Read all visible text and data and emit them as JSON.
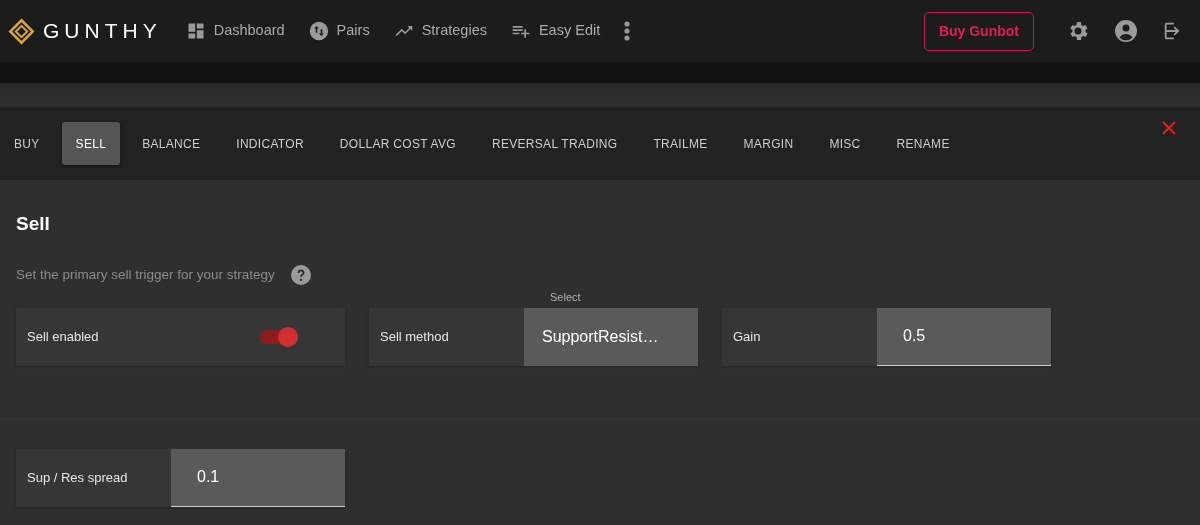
{
  "brand": "GUNTHY",
  "nav": [
    {
      "label": "Dashboard"
    },
    {
      "label": "Pairs"
    },
    {
      "label": "Strategies"
    },
    {
      "label": "Easy Edit"
    }
  ],
  "buy_button": "Buy Gunbot",
  "tabs": [
    {
      "label": "BUY",
      "selected": false
    },
    {
      "label": "SELL",
      "selected": true
    },
    {
      "label": "BALANCE",
      "selected": false
    },
    {
      "label": "INDICATOR",
      "selected": false
    },
    {
      "label": "DOLLAR COST AVG",
      "selected": false
    },
    {
      "label": "REVERSAL TRADING",
      "selected": false
    },
    {
      "label": "TRAILME",
      "selected": false
    },
    {
      "label": "MARGIN",
      "selected": false
    },
    {
      "label": "MISC",
      "selected": false
    },
    {
      "label": "RENAME",
      "selected": false
    }
  ],
  "section": {
    "title": "Sell",
    "description": "Set the primary sell trigger for your strategy",
    "settings": [
      {
        "kind": "toggle",
        "label": "Sell enabled",
        "on": true
      },
      {
        "kind": "select",
        "label": "Sell method",
        "floating_label": "Select",
        "value": "SupportResist…"
      },
      {
        "kind": "input",
        "label": "Gain",
        "value": "0.5"
      }
    ],
    "more_settings": [
      {
        "kind": "input",
        "label": "Sup / Res spread",
        "value": "0.1"
      }
    ]
  }
}
